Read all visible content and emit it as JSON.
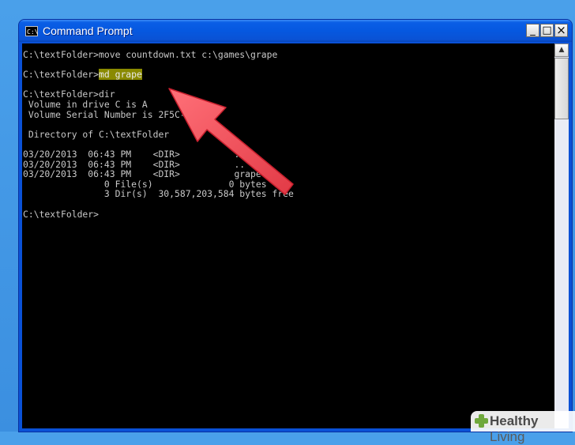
{
  "window": {
    "title": "Command Prompt",
    "icon_glyph": "C:\\",
    "buttons": {
      "minimize": "_",
      "maximize": "□",
      "close": "×"
    }
  },
  "terminal": {
    "lines": [
      "C:\\textFolder>move countdown.txt c:\\games\\grape",
      "",
      "C:\\textFolder>",
      "",
      "C:\\textFolder>dir",
      " Volume in drive C is A",
      " Volume Serial Number is 2F5C-0C4E",
      "",
      " Directory of C:\\textFolder",
      "",
      "03/20/2013  06:43 PM    <DIR>          .",
      "03/20/2013  06:43 PM    <DIR>          ..",
      "03/20/2013  06:43 PM    <DIR>          grape",
      "               0 File(s)              0 bytes",
      "               3 Dir(s)  30,587,203,584 bytes free",
      "",
      "C:\\textFolder>"
    ],
    "highlighted_command": "md grape",
    "foreground_color": "#c8c8c8",
    "background_color": "#000000",
    "highlight_color": "#8a8a00"
  },
  "annotation": {
    "type": "red-arrow-icon",
    "color": "#f0505a"
  },
  "watermark": {
    "brand_bold": "Healthy",
    "brand_light": "Living"
  }
}
